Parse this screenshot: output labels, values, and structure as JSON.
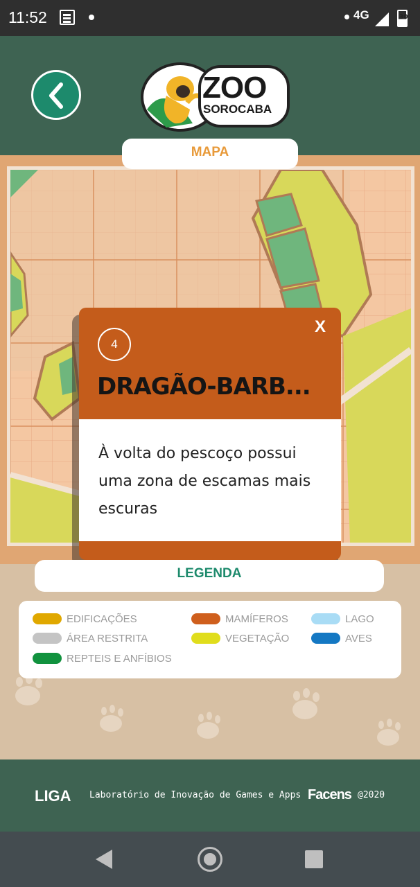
{
  "status_bar": {
    "time": "11:52",
    "network": "4G",
    "battery": "30"
  },
  "header": {
    "logo_line1": "ZOO",
    "logo_line2": "SOROCABA",
    "section_title": "MAPA"
  },
  "modal": {
    "number": "4",
    "close_label": "X",
    "title": "DRAGÃO-BARB...",
    "description": "À volta do pescoço possui uma zona de escamas mais escuras"
  },
  "legend": {
    "title": "LEGENDA",
    "items": [
      {
        "label": "EDIFICAÇÕES",
        "color": "#e0a800"
      },
      {
        "label": "MAMÍFEROS",
        "color": "#cf5f1d"
      },
      {
        "label": "LAGO",
        "color": "#a9dcf5"
      },
      {
        "label": "ÁREA RESTRITA",
        "color": "#c4c4c4"
      },
      {
        "label": "VEGETAÇÃO",
        "color": "#e0dd1c"
      },
      {
        "label": "AVES",
        "color": "#1478c3"
      },
      {
        "label": "REPTEIS E ANFÍBIOS",
        "color": "#11923e"
      }
    ]
  },
  "footer": {
    "liga": "LIGA",
    "lab_text": "Laboratório de Inovação de Games e Apps",
    "facens": "Facens",
    "year": "@2020"
  },
  "colors": {
    "header_green": "#3e6352",
    "accent_orange": "#c45c1b",
    "accent_green": "#1d8a6c"
  }
}
